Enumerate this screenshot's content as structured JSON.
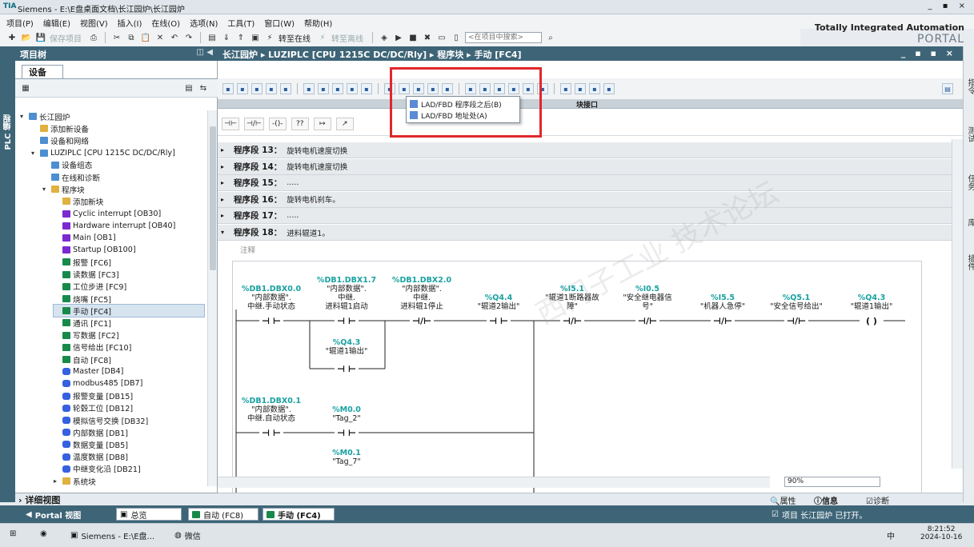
{
  "titlebar": {
    "app": "Siemens",
    "path": " - E:\\E盘桌面文档\\长江园炉\\长江园炉",
    "controls": "_ ▪ ×"
  },
  "menu": [
    "项目(P)",
    "编辑(E)",
    "视图(V)",
    "插入(I)",
    "在线(O)",
    "选项(N)",
    "工具(T)",
    "窗口(W)",
    "帮助(H)"
  ],
  "toolbar": {
    "save": "保存项目",
    "online": "转至在线",
    "offline": "转至离线",
    "search_placeholder": "<在项目中搜索>"
  },
  "brand": {
    "line1": "Totally Integrated Automation",
    "line2": "PORTAL"
  },
  "left_strip": "PLC 编程",
  "tree": {
    "header": "项目树",
    "header_btns": "◫ ◀",
    "tab": "设备",
    "items": [
      {
        "label": "长江园炉",
        "indent": 0,
        "icon": "project"
      },
      {
        "label": "添加新设备",
        "indent": 1,
        "icon": "add"
      },
      {
        "label": "设备和网络",
        "indent": 1,
        "icon": "network"
      },
      {
        "label": "LUZIPLC [CPU 1215C DC/DC/Rly]",
        "indent": 1,
        "icon": "plc"
      },
      {
        "label": "设备组态",
        "indent": 2,
        "icon": "config"
      },
      {
        "label": "在线和诊断",
        "indent": 2,
        "icon": "diag"
      },
      {
        "label": "程序块",
        "indent": 2,
        "icon": "folder"
      },
      {
        "label": "添加新块",
        "indent": 3,
        "icon": "add"
      },
      {
        "label": "Cyclic interrupt [OB30]",
        "indent": 3,
        "icon": "ob"
      },
      {
        "label": "Hardware interrupt [OB40]",
        "indent": 3,
        "icon": "ob"
      },
      {
        "label": "Main [OB1]",
        "indent": 3,
        "icon": "ob"
      },
      {
        "label": "Startup [OB100]",
        "indent": 3,
        "icon": "ob"
      },
      {
        "label": "报警 [FC6]",
        "indent": 3,
        "icon": "fc"
      },
      {
        "label": "读数据 [FC3]",
        "indent": 3,
        "icon": "fc"
      },
      {
        "label": "工位步进 [FC9]",
        "indent": 3,
        "icon": "fc"
      },
      {
        "label": "烧嘴 [FC5]",
        "indent": 3,
        "icon": "fc"
      },
      {
        "label": "手动 [FC4]",
        "indent": 3,
        "icon": "fc"
      },
      {
        "label": "通讯 [FC1]",
        "indent": 3,
        "icon": "fc"
      },
      {
        "label": "写数据 [FC2]",
        "indent": 3,
        "icon": "fc"
      },
      {
        "label": "信号给出 [FC10]",
        "indent": 3,
        "icon": "fc"
      },
      {
        "label": "自动 [FC8]",
        "indent": 3,
        "icon": "fc"
      },
      {
        "label": "Master [DB4]",
        "indent": 3,
        "icon": "db"
      },
      {
        "label": "modbus485 [DB7]",
        "indent": 3,
        "icon": "db"
      },
      {
        "label": "报警变量 [DB15]",
        "indent": 3,
        "icon": "db"
      },
      {
        "label": "轮毂工位 [DB12]",
        "indent": 3,
        "icon": "db"
      },
      {
        "label": "模拟信号交换 [DB32]",
        "indent": 3,
        "icon": "db"
      },
      {
        "label": "内部数据 [DB1]",
        "indent": 3,
        "icon": "db"
      },
      {
        "label": "数据变量 [DB5]",
        "indent": 3,
        "icon": "db"
      },
      {
        "label": "温度数据 [DB8]",
        "indent": 3,
        "icon": "db"
      },
      {
        "label": "中继变化沿 [DB21]",
        "indent": 3,
        "icon": "db"
      },
      {
        "label": "系统块",
        "indent": 3,
        "icon": "folder"
      }
    ],
    "detail": "详细视图"
  },
  "editor": {
    "breadcrumb": "长江园炉 ▸ LUZIPLC [CPU 1215C DC/DC/Rly] ▸ 程序块 ▸ 手动 [FC4]",
    "controls": "_ ▪ ▪ ×",
    "ruler_label": "块接口",
    "favorites": [
      "⊣⊢",
      "⊣/⊢",
      "-()-",
      "??",
      "↦",
      "↗"
    ],
    "segments": [
      {
        "name": "程序段 13：",
        "comment": "旋转电机速度切换"
      },
      {
        "name": "程序段 14：",
        "comment": "旋转电机速度切换"
      },
      {
        "name": "程序段 15：",
        "comment": "....."
      },
      {
        "name": "程序段 16：",
        "comment": "旋转电机刹车。"
      },
      {
        "name": "程序段 17：",
        "comment": "....."
      },
      {
        "name": "程序段 18：",
        "comment": "进料辊道1。"
      }
    ],
    "comment_label": "注释",
    "zoom": "90%",
    "popup": [
      "LAD/FBD 程序段之后(B)",
      "LAD/FBD 地址处(A)"
    ],
    "rung1": [
      {
        "addr": "%DB1.DBX0.0",
        "lines": [
          "\"内部数据\".",
          "中继.手动状态"
        ]
      },
      {
        "addr": "%DB1.DBX1.7",
        "lines": [
          "\"内部数据\".",
          "中继.",
          "进料辊1启动"
        ]
      },
      {
        "addr": "%DB1.DBX2.0",
        "lines": [
          "\"内部数据\".",
          "中继.",
          "进料辊1停止"
        ]
      },
      {
        "addr": "%Q4.4",
        "lines": [
          "\"辊道2输出\""
        ]
      },
      {
        "addr": "%I5.1",
        "lines": [
          "\"辊道1断路器故",
          "障\""
        ]
      },
      {
        "addr": "%I0.5",
        "lines": [
          "\"安全继电器信",
          "号\""
        ]
      },
      {
        "addr": "%I5.5",
        "lines": [
          "\"机器人急停\""
        ]
      },
      {
        "addr": "%Q5.1",
        "lines": [
          "\"安全信号给出\""
        ]
      },
      {
        "addr": "%Q4.3",
        "lines": [
          "\"辊道1输出\""
        ]
      }
    ],
    "branch1": {
      "addr": "%Q4.3",
      "lines": [
        "\"辊道1输出\""
      ]
    },
    "rung2": [
      {
        "addr": "%DB1.DBX0.1",
        "lines": [
          "\"内部数据\".",
          "中继.自动状态"
        ]
      },
      {
        "addr": "%M0.0",
        "lines": [
          "\"Tag_2\""
        ]
      }
    ],
    "rung3": {
      "addr": "%M0.1",
      "lines": [
        "\"Tag_7\""
      ]
    }
  },
  "right_strip": [
    "指令",
    "测试",
    "任务",
    "库",
    "插件"
  ],
  "status": {
    "props": "属性",
    "info": "信息",
    "diag": "诊断"
  },
  "portal": {
    "view": "Portal 视图",
    "tabs": [
      "总览",
      "自动 (FC8)",
      "手动 (FC4)"
    ],
    "msg": "项目 长江园炉 已打开。"
  },
  "taskbar": {
    "app1": "Siemens - E:\\E盘...",
    "app2": "微信",
    "ime": "中",
    "time": "8:21:52",
    "date": "2024-10-16"
  }
}
